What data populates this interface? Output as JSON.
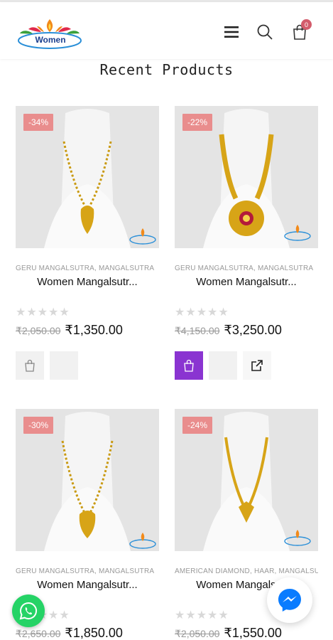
{
  "header": {
    "logo_text": "Women",
    "cart_count": "0"
  },
  "section_title": "Recent Products",
  "products": [
    {
      "discount": "-34%",
      "categories": "GERU MANGALSUTRA, MANGALSUTRA",
      "name": "Women Mangalsutr...",
      "old_price": "₹2,050.00",
      "new_price": "₹1,350.00",
      "rating": 0
    },
    {
      "discount": "-22%",
      "categories": "GERU MANGALSUTRA, MANGALSUTRA",
      "name": "Women Mangalsutr...",
      "old_price": "₹4,150.00",
      "new_price": "₹3,250.00",
      "rating": 0
    },
    {
      "discount": "-30%",
      "categories": "GERU MANGALSUTRA, MANGALSUTRA",
      "name": "Women Mangalsutr...",
      "old_price": "₹2,650.00",
      "new_price": "₹1,850.00",
      "rating": 0
    },
    {
      "discount": "-24%",
      "categories": "AMERICAN DIAMOND, HAAR, MANGALSUTRA",
      "name": "Women Mangalsutr...",
      "old_price": "₹2,050.00",
      "new_price": "₹1,550.00",
      "rating": 0
    }
  ],
  "colors": {
    "badge": "#e98d8d",
    "accent": "#8a34d1",
    "whatsapp": "#25d366",
    "messenger": "#0a7cff"
  },
  "icons": {
    "menu": "menu-icon",
    "search": "search-icon",
    "cart": "shopping-bag-icon",
    "add_to_cart": "shopping-bag-icon",
    "external": "external-link-icon",
    "whatsapp": "whatsapp-icon",
    "messenger": "messenger-icon"
  }
}
